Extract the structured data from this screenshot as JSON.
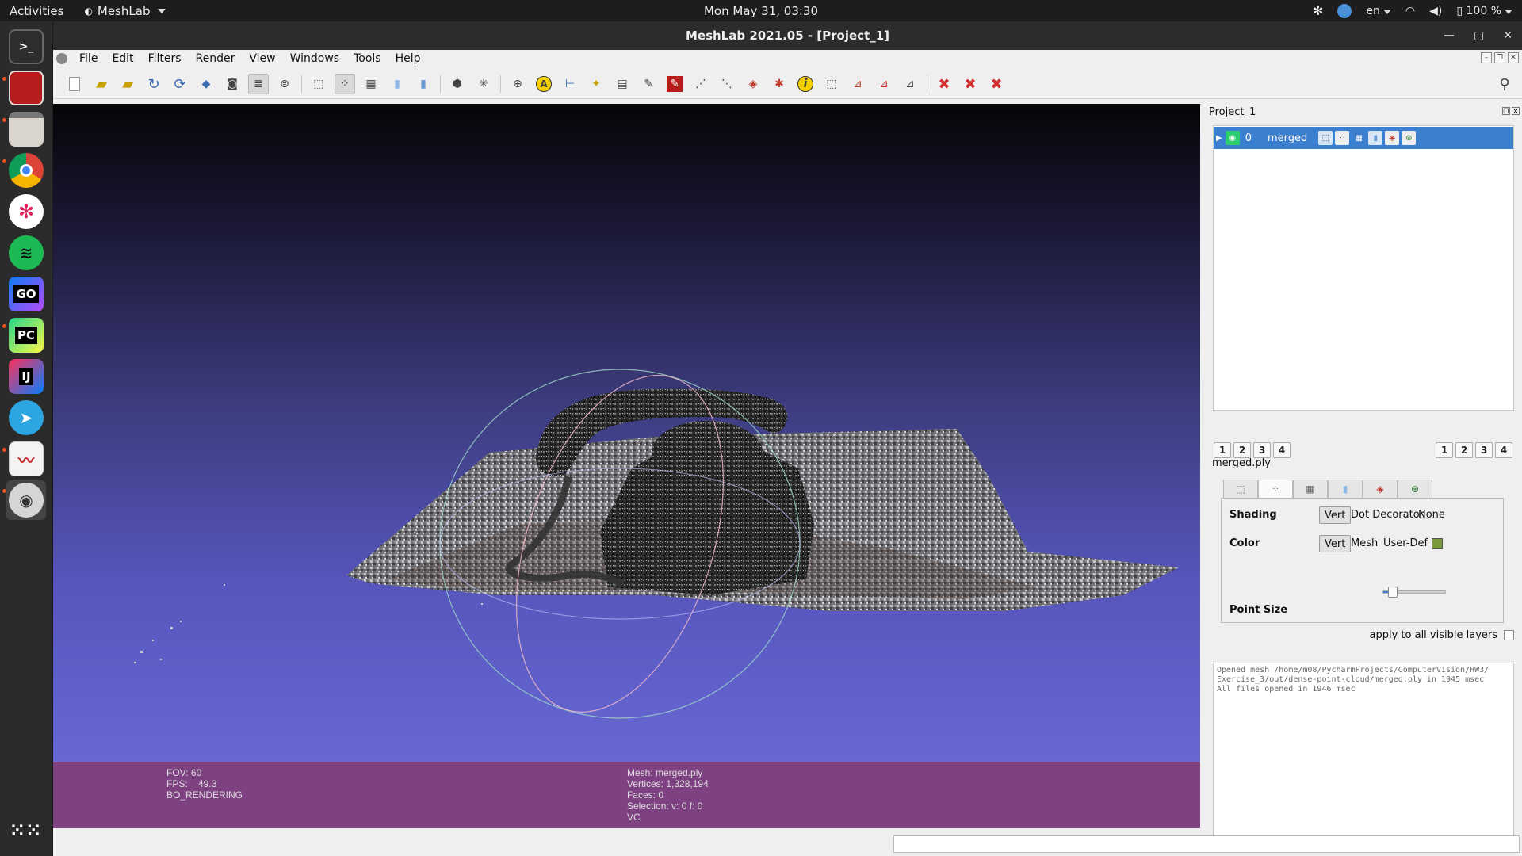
{
  "topbar": {
    "activities": "Activities",
    "app": "MeshLab",
    "clock": "Mon May 31, 03:30",
    "lang": "en",
    "battery": "100 %"
  },
  "dock": {
    "items": [
      "terminal-icon",
      "filezilla-icon",
      "files-icon",
      "chrome-icon",
      "slack-icon",
      "spotify-icon",
      "goland-icon",
      "pycharm-icon",
      "intellij-icon",
      "telegram-icon",
      "document-viewer-icon",
      "meshlab-icon"
    ],
    "go_label": "GO",
    "pc_label": "PC",
    "ij_label": "IJ"
  },
  "window": {
    "title": "MeshLab 2021.05 - [Project_1]"
  },
  "menu": {
    "file": "File",
    "edit": "Edit",
    "filters": "Filters",
    "render": "Render",
    "view": "View",
    "windows": "Windows",
    "tools": "Tools",
    "help": "Help"
  },
  "toolbar": {
    "annotation_letter": "A",
    "info_letter": "i"
  },
  "viewport_info": {
    "fov": "FOV: 60",
    "fps": "FPS:    49.3",
    "rendering": "BO_RENDERING",
    "mesh": "Mesh: merged.ply",
    "vertices": "Vertices: 1,328,194",
    "faces": "Faces: 0",
    "selection": "Selection: v: 0 f: 0",
    "vc": "VC"
  },
  "panel": {
    "title": "Project_1",
    "layer": {
      "index": "0",
      "name": "merged"
    },
    "left_nums": [
      "1",
      "2",
      "3",
      "4"
    ],
    "right_nums": [
      "1",
      "2",
      "3",
      "4"
    ],
    "filename": "merged.ply",
    "shading_label": "Shading",
    "shading_options": [
      "Vert",
      "Dot Decorator",
      "None"
    ],
    "color_label": "Color",
    "color_options": [
      "Vert",
      "Mesh",
      "User-Def"
    ],
    "userdef_color": "#7a9a3a",
    "point_size_label": "Point Size",
    "point_size_fraction": 0.15,
    "apply_all": "apply to all visible layers",
    "log_lines": [
      "Opened mesh /home/m08/PycharmProjects/ComputerVision/HW3/",
      "Exercise_3/out/dense-point-cloud/merged.ply in 1945 msec",
      "All files opened in 1946 msec"
    ]
  },
  "colors": {
    "selection_blue": "#3a7fd0",
    "info_bar": "#7e4282"
  }
}
